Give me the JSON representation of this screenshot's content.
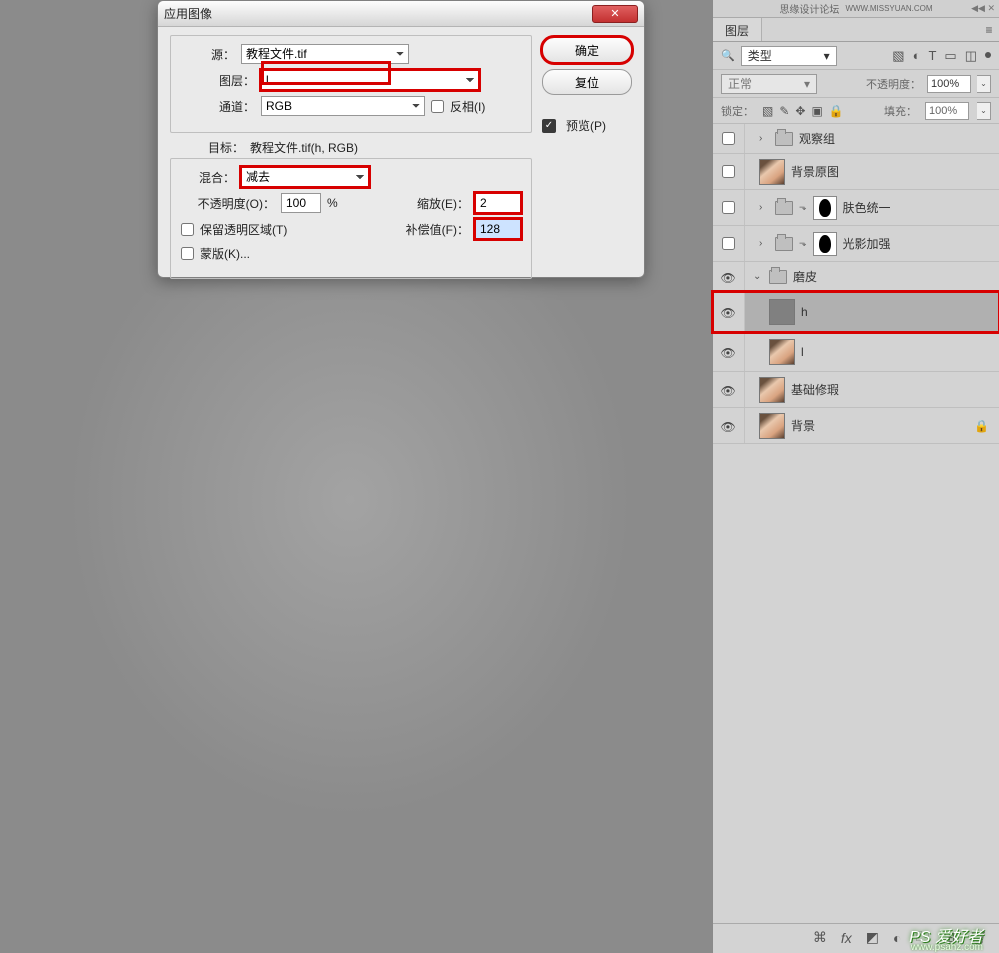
{
  "dialog": {
    "title": "应用图像",
    "source": {
      "label": "源：",
      "value": "教程文件.tif"
    },
    "layer": {
      "label": "图层：",
      "value": "l"
    },
    "channel": {
      "label": "通道：",
      "value": "RGB"
    },
    "invert": {
      "label": "反相(I)"
    },
    "target_label": "目标：",
    "target_value": "教程文件.tif(h, RGB)",
    "blend": {
      "label": "混合：",
      "value": "减去"
    },
    "opacity": {
      "label": "不透明度(O)：",
      "value": "100",
      "unit": "%"
    },
    "scale": {
      "label": "缩放(E)：",
      "value": "2"
    },
    "offset": {
      "label": "补偿值(F)：",
      "value": "128"
    },
    "preserve_transparency": "保留透明区域(T)",
    "mask": "蒙版(K)...",
    "ok": "确定",
    "reset": "复位",
    "preview": "预览(P)"
  },
  "panel": {
    "forum_text": "思缘设计论坛",
    "forum_url": "WWW.MISSYUAN.COM",
    "tab": "图层",
    "filter_kind": "类型",
    "blend_mode": "正常",
    "opacity_label": "不透明度：",
    "opacity_value": "100%",
    "lock_label": "锁定：",
    "fill_label": "填充：",
    "fill_value": "100%",
    "layers": {
      "g1": "观察组",
      "g2": "背景原图",
      "g3": "肤色统一",
      "g4": "光影加强",
      "g5": "磨皮",
      "h": "h",
      "l": "l",
      "base_fix": "基础修瑕",
      "bg": "背景"
    }
  },
  "watermark": {
    "main": "PS 爱好者",
    "sub": "www.psahz.com"
  },
  "icons": {
    "search": "🔍",
    "check": "✓",
    "chev_down": "▾",
    "chev_right": "›",
    "eye": "👁",
    "lock": "🔒",
    "link": "⬤",
    "fx": "fx",
    "mask": "◩",
    "adjust": "◐",
    "folder": "🗀",
    "new": "⬒",
    "trash": "🗑"
  }
}
